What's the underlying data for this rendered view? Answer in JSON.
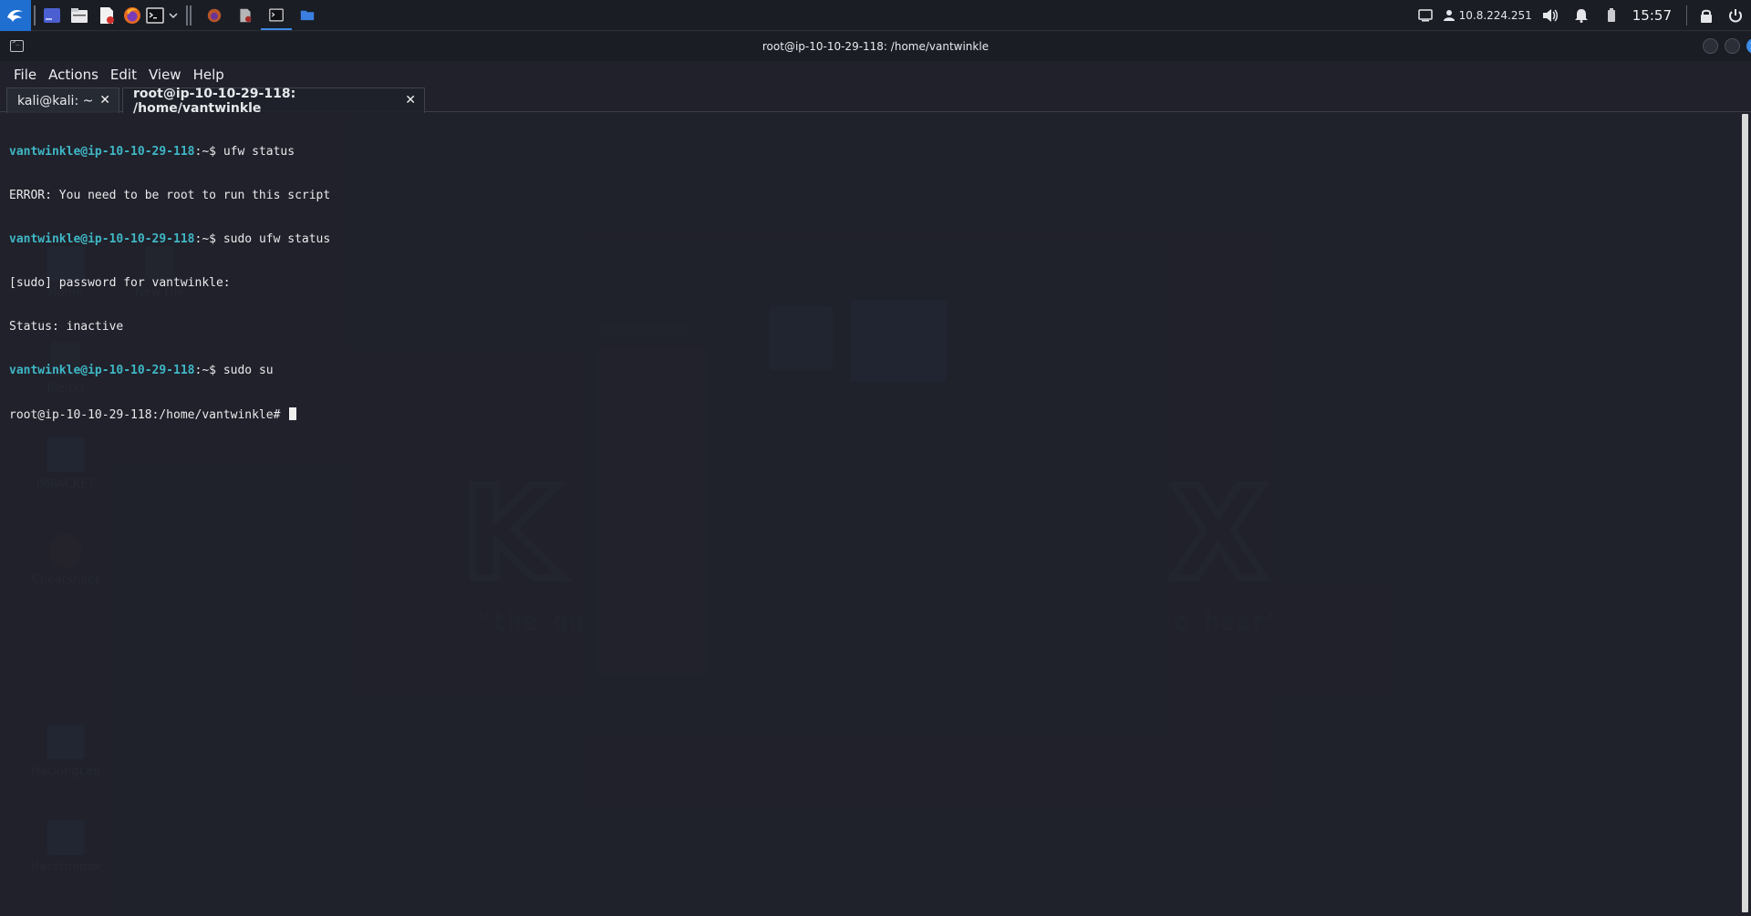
{
  "panel": {
    "apps": [
      {
        "name": "kali-menu-icon"
      },
      {
        "name": "show-desktop-icon"
      },
      {
        "name": "file-manager-icon"
      },
      {
        "name": "text-editor-icon"
      },
      {
        "name": "firefox-icon"
      },
      {
        "name": "terminal-icon"
      },
      {
        "name": "chevron-down-icon"
      }
    ],
    "tasks": [
      {
        "name": "firefox-task-icon"
      },
      {
        "name": "editor-task-icon"
      },
      {
        "name": "terminal-task-icon"
      },
      {
        "name": "folder-task-icon"
      }
    ],
    "vpn_ip": "10.8.224.251",
    "clock": "15:57"
  },
  "terminal": {
    "title": "root@ip-10-10-29-118: /home/vantwinkle",
    "menus": [
      "File",
      "Actions",
      "Edit",
      "View",
      "Help"
    ],
    "tabs": [
      {
        "label": "kali@kali: ~",
        "close": "✕"
      },
      {
        "label": "root@ip-10-10-29-118: /home/vantwinkle",
        "close": "✕"
      }
    ],
    "lines": [
      {
        "user": "vantwinkle@ip-10-10-29-118",
        "path": ":~$ ",
        "text": "ufw status"
      },
      {
        "text": "ERROR: You need to be root to run this script"
      },
      {
        "user": "vantwinkle@ip-10-10-29-118",
        "path": ":~$ ",
        "text": "sudo ufw status"
      },
      {
        "text": "[sudo] password for vantwinkle:"
      },
      {
        "text": "Status: inactive"
      },
      {
        "user": "vantwinkle@ip-10-10-29-118",
        "path": ":~$ ",
        "text": "sudo su"
      },
      {
        "text": "root@ip-10-10-29-118:/home/vantwinkle# "
      }
    ]
  },
  "colors": {
    "prompt_user": "#3fb7c6",
    "close_button": "#3b8ae6",
    "accent": "#3b8ae6"
  }
}
